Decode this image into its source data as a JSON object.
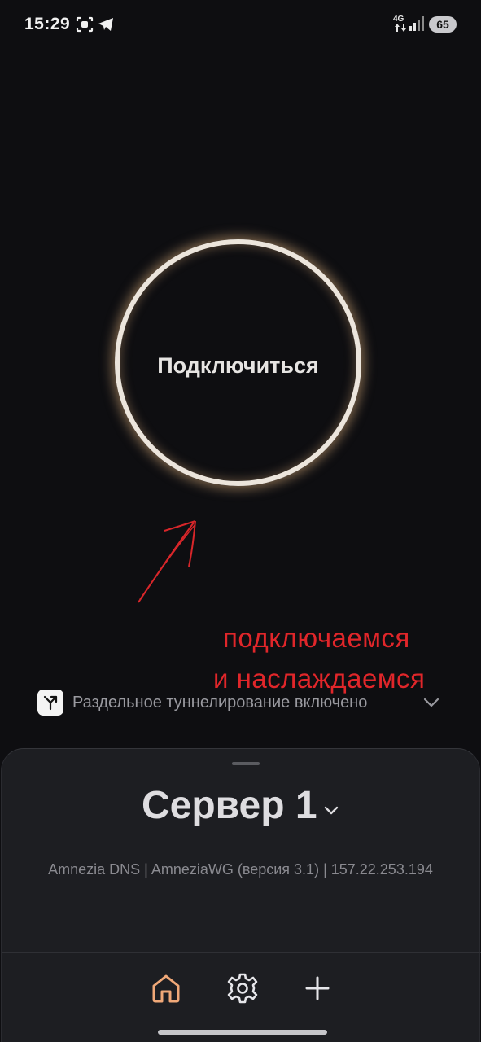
{
  "status_bar": {
    "time": "15:29",
    "network": "4G",
    "battery": "65",
    "icons": [
      "screenshot-icon",
      "telegram-icon",
      "signal-icon"
    ]
  },
  "connect": {
    "label": "Подключиться",
    "ring_color": "#ece5dc",
    "glow_color": "#d6aa78"
  },
  "annotation": {
    "line1": "подключаемся",
    "line2": "и наслаждаемся",
    "color": "#e0262a"
  },
  "split_tunneling": {
    "label": "Раздельное туннелирование включено",
    "icon": "split-tunnel-icon"
  },
  "server": {
    "name": "Сервер 1",
    "details": "Amnezia DNS | AmneziaWG (версия 3.1) | 157.22.253.194"
  },
  "nav": {
    "items": [
      "home-icon",
      "settings-icon",
      "add-icon"
    ],
    "active_color": "#f0a878"
  }
}
